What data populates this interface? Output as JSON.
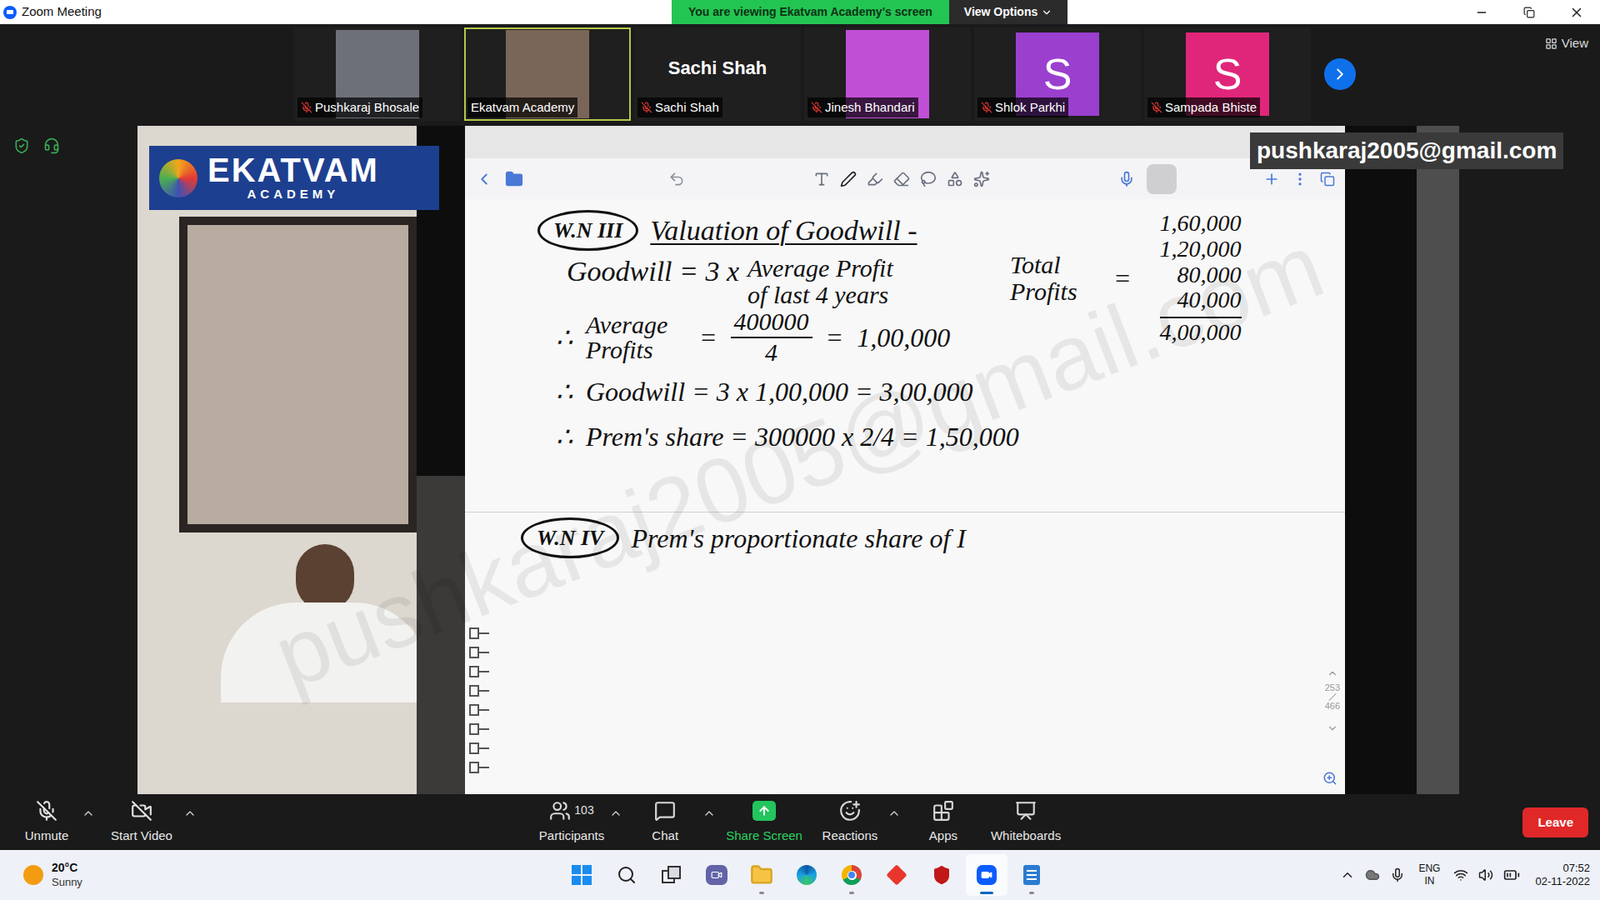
{
  "window": {
    "title": "Zoom Meeting"
  },
  "share_banner": {
    "text": "You are viewing Ekatvam Academy's screen",
    "button": "View Options"
  },
  "view_button": {
    "label": "View"
  },
  "participants": [
    {
      "name": "Pushkaraj Bhosale",
      "kind": "image",
      "muted": true,
      "selected": false,
      "color": "#6d7078"
    },
    {
      "name": "Ekatvam Academy",
      "kind": "image",
      "muted": false,
      "selected": true,
      "color": "#7a6658"
    },
    {
      "name": "Sachi Shah",
      "kind": "name",
      "muted": true,
      "selected": false
    },
    {
      "name": "Jinesh Bhandari",
      "kind": "image",
      "muted": true,
      "selected": false,
      "color": "#c04fd6"
    },
    {
      "name": "Shlok Parkhi",
      "kind": "avatar",
      "letter": "S",
      "muted": true,
      "selected": false,
      "color": "#9b3fcf"
    },
    {
      "name": "Sampada Bhiste",
      "kind": "avatar",
      "letter": "S",
      "muted": true,
      "selected": false,
      "color": "#e0267a"
    }
  ],
  "shared_screen": {
    "logo": {
      "title": "EKATVAM",
      "subtitle": "ACADEMY"
    },
    "recorder_label": "pushkaraj2005@gmail.com",
    "watermark": "pushkaraj2005@gmail.com",
    "notes": {
      "wn3": {
        "tag": "W.N III",
        "title": "Valuation of Goodwill -",
        "formula": {
          "lhs": "Goodwill = 3 x",
          "term": [
            "Average Profit",
            "of last 4 years"
          ]
        },
        "totals": {
          "label": "Total Profits",
          "eq": "=",
          "values": [
            "1,60,000",
            "1,20,000",
            "80,000",
            "40,000"
          ],
          "sum": "4,00,000"
        },
        "steps": [
          {
            "kind": "fraction",
            "therefore": "∴",
            "label": "Average Profits",
            "eq": "=",
            "numerator": "400000",
            "denominator": "4",
            "result": "1,00,000"
          },
          {
            "kind": "line",
            "therefore": "∴",
            "text": "Goodwill = 3 x 1,00,000 = 3,00,000"
          },
          {
            "kind": "line",
            "therefore": "∴",
            "text": "Prem's share = 300000 x 2/4 = 1,50,000"
          }
        ]
      },
      "wn4": {
        "tag": "W.N IV",
        "title": "Prem's proportionate share of I"
      }
    },
    "page_indicator": {
      "current": "253",
      "total": "466"
    }
  },
  "toolbar": {
    "left_items": [
      {
        "label": "Unmute",
        "kind": "mic",
        "caret": true,
        "highlight": false
      },
      {
        "label": "Start Video",
        "kind": "video",
        "caret": true,
        "highlight": false
      }
    ],
    "center_items": [
      {
        "label": "Participants",
        "kind": "users",
        "count": "103",
        "caret": true,
        "highlight": false
      },
      {
        "label": "Chat",
        "kind": "chat",
        "caret": true,
        "highlight": false
      },
      {
        "label": "Share Screen",
        "kind": "share",
        "caret": false,
        "highlight": true
      },
      {
        "label": "Reactions",
        "kind": "reactions",
        "caret": true,
        "highlight": false
      },
      {
        "label": "Apps",
        "kind": "apps",
        "caret": false,
        "highlight": false
      },
      {
        "label": "Whiteboards",
        "kind": "whiteboard",
        "caret": false,
        "highlight": false
      }
    ],
    "leave": "Leave"
  },
  "taskbar": {
    "weather": {
      "temp": "20°C",
      "condition": "Sunny"
    },
    "apps": [
      {
        "kind": "start",
        "running": false,
        "active": false
      },
      {
        "kind": "search",
        "running": false,
        "active": false
      },
      {
        "kind": "taskview",
        "running": false,
        "active": false
      },
      {
        "kind": "teams",
        "running": false,
        "active": false
      },
      {
        "kind": "explorer",
        "running": true,
        "active": false
      },
      {
        "kind": "edge",
        "running": false,
        "active": false
      },
      {
        "kind": "chrome",
        "running": true,
        "active": false
      },
      {
        "kind": "app",
        "running": false,
        "active": false
      },
      {
        "kind": "mcafee",
        "running": false,
        "active": false
      },
      {
        "kind": "zoom",
        "running": true,
        "active": true
      },
      {
        "kind": "notepad",
        "running": true,
        "active": false
      }
    ],
    "language": {
      "code": "ENG",
      "region": "IN"
    },
    "clock": {
      "time": "07:52",
      "date": "02-11-2022"
    }
  }
}
